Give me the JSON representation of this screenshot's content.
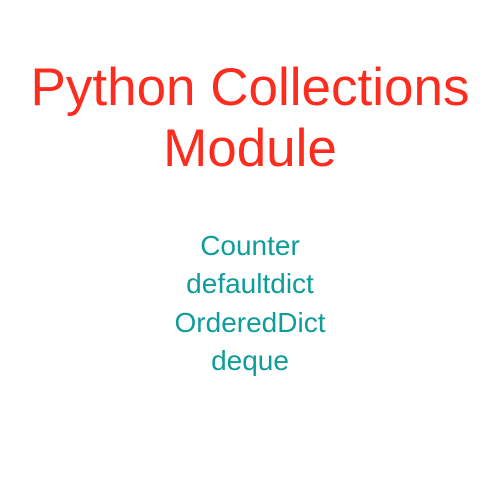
{
  "title": "Python Collections Module",
  "items": [
    "Counter",
    "defaultdict",
    "OrderedDict",
    "deque"
  ]
}
